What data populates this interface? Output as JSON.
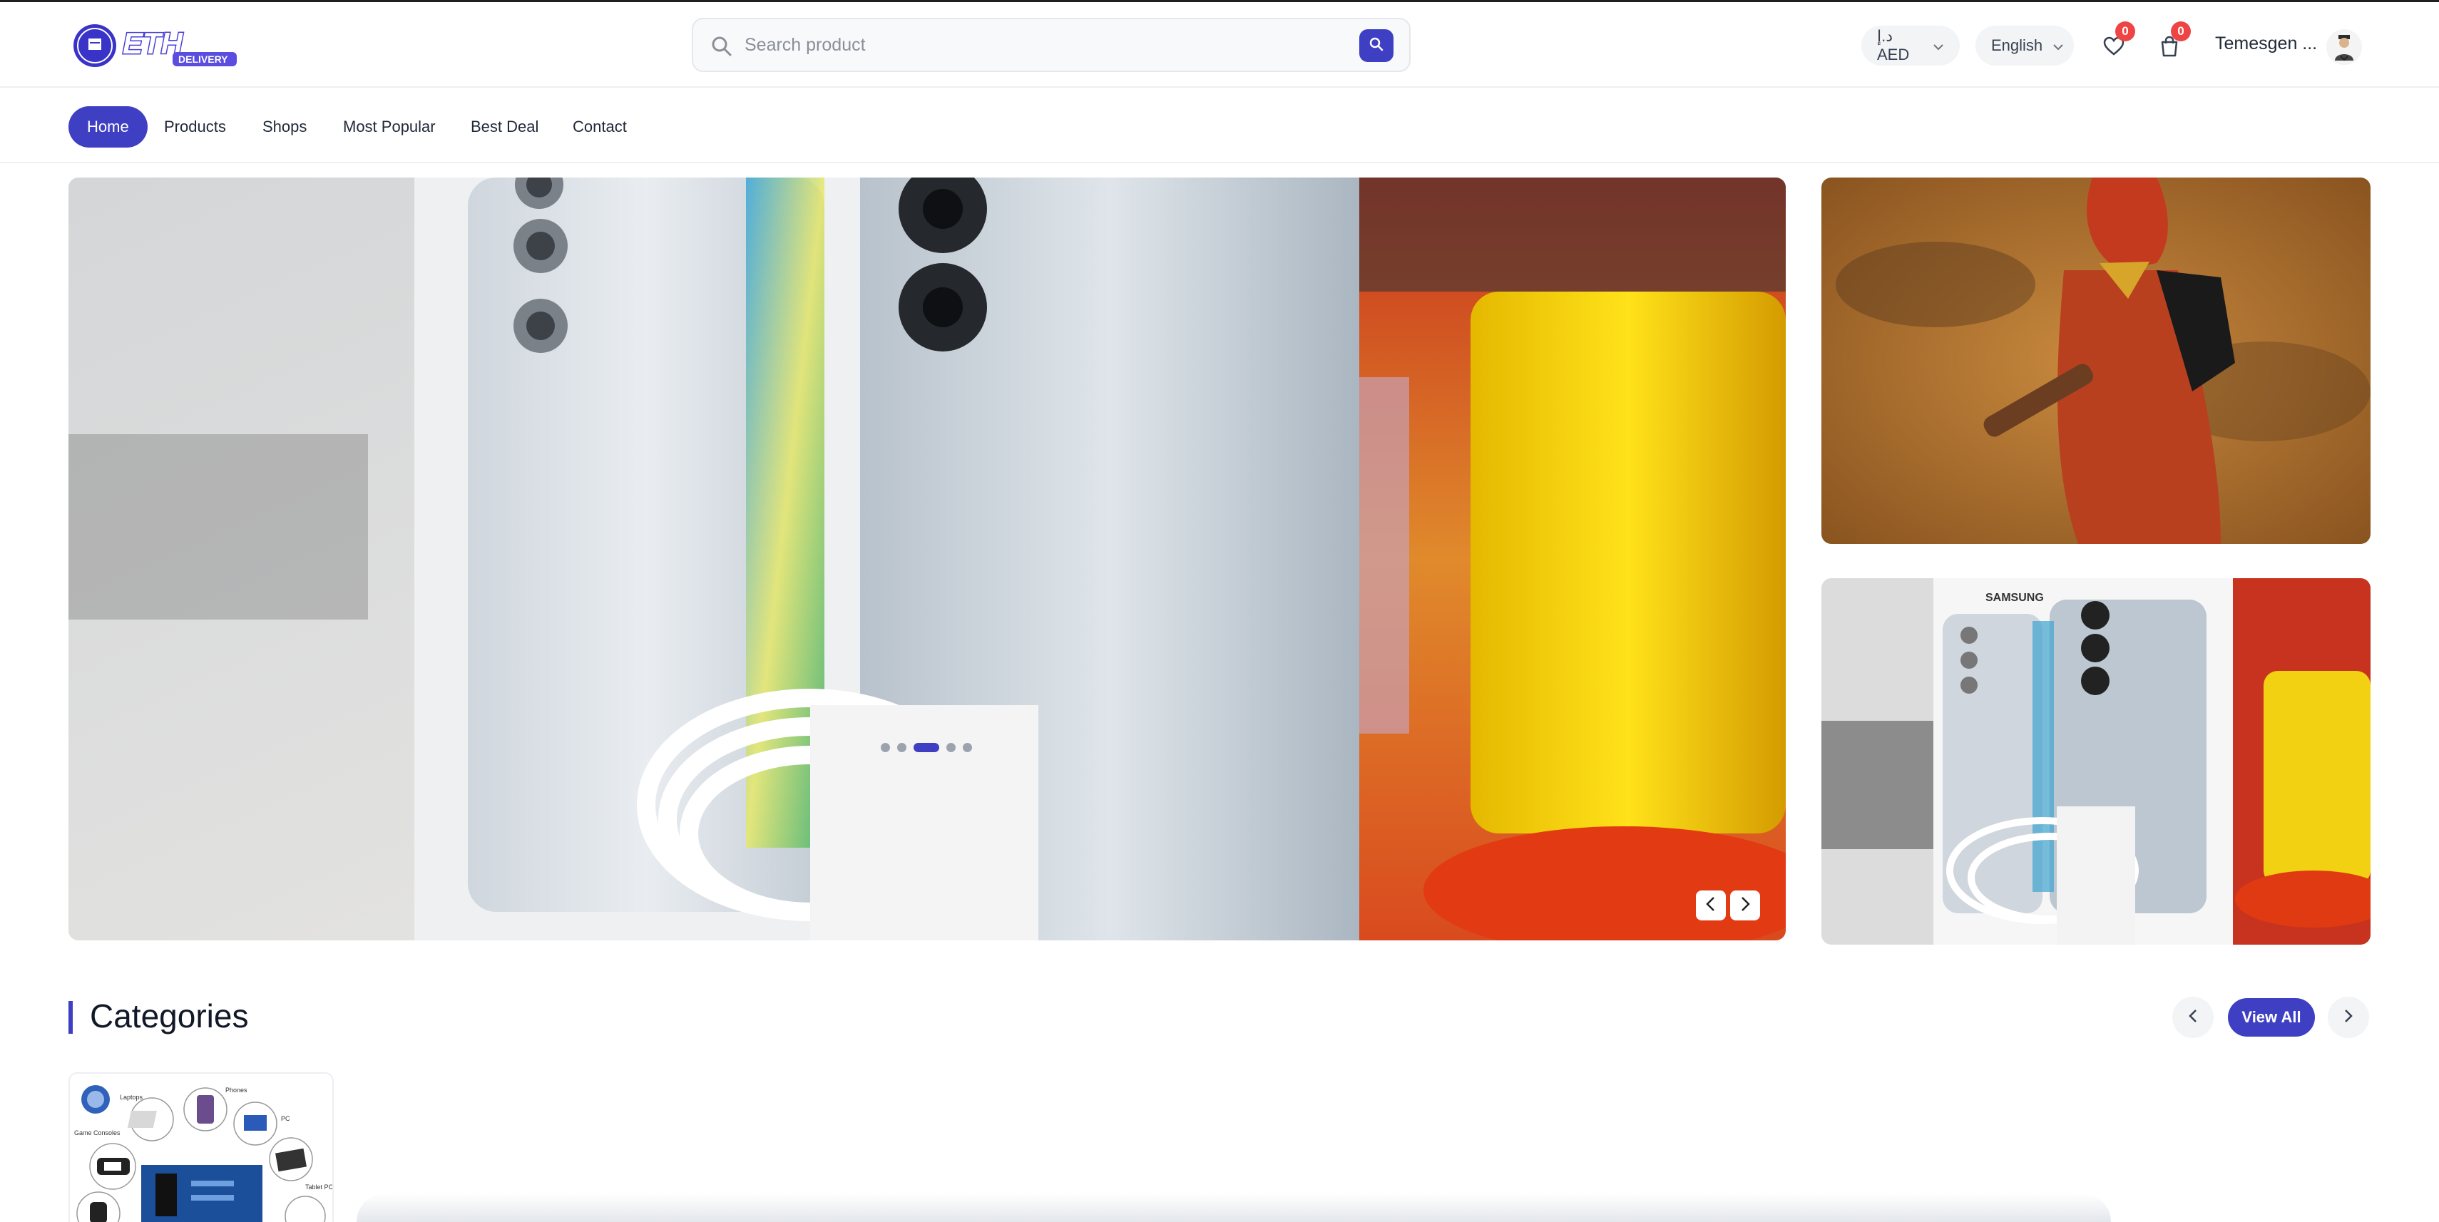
{
  "colors": {
    "accent": "#3f3fc4",
    "badge": "#ef4444"
  },
  "header": {
    "logo_text": "ETH",
    "logo_sub": "DELIVERY",
    "search": {
      "placeholder": "Search product",
      "icon": "search-icon"
    },
    "currency": "د.إ AED",
    "language": "English",
    "wishlist_count": "0",
    "cart_count": "0",
    "user_name": "Temesgen ..."
  },
  "nav": {
    "items": [
      {
        "label": "Home",
        "active": true
      },
      {
        "label": "Products"
      },
      {
        "label": "Shops"
      },
      {
        "label": "Most Popular"
      },
      {
        "label": "Best Deal"
      },
      {
        "label": "Contact"
      }
    ]
  },
  "hero": {
    "slide_count": 5,
    "active_slide": 3,
    "side_banner_brand": "SAMSUNG"
  },
  "categories": {
    "title": "Categories",
    "view_all": "View All",
    "card_labels": [
      "Laptops",
      "Phones",
      "PC",
      "Game Consoles",
      "Tablet PC"
    ]
  }
}
